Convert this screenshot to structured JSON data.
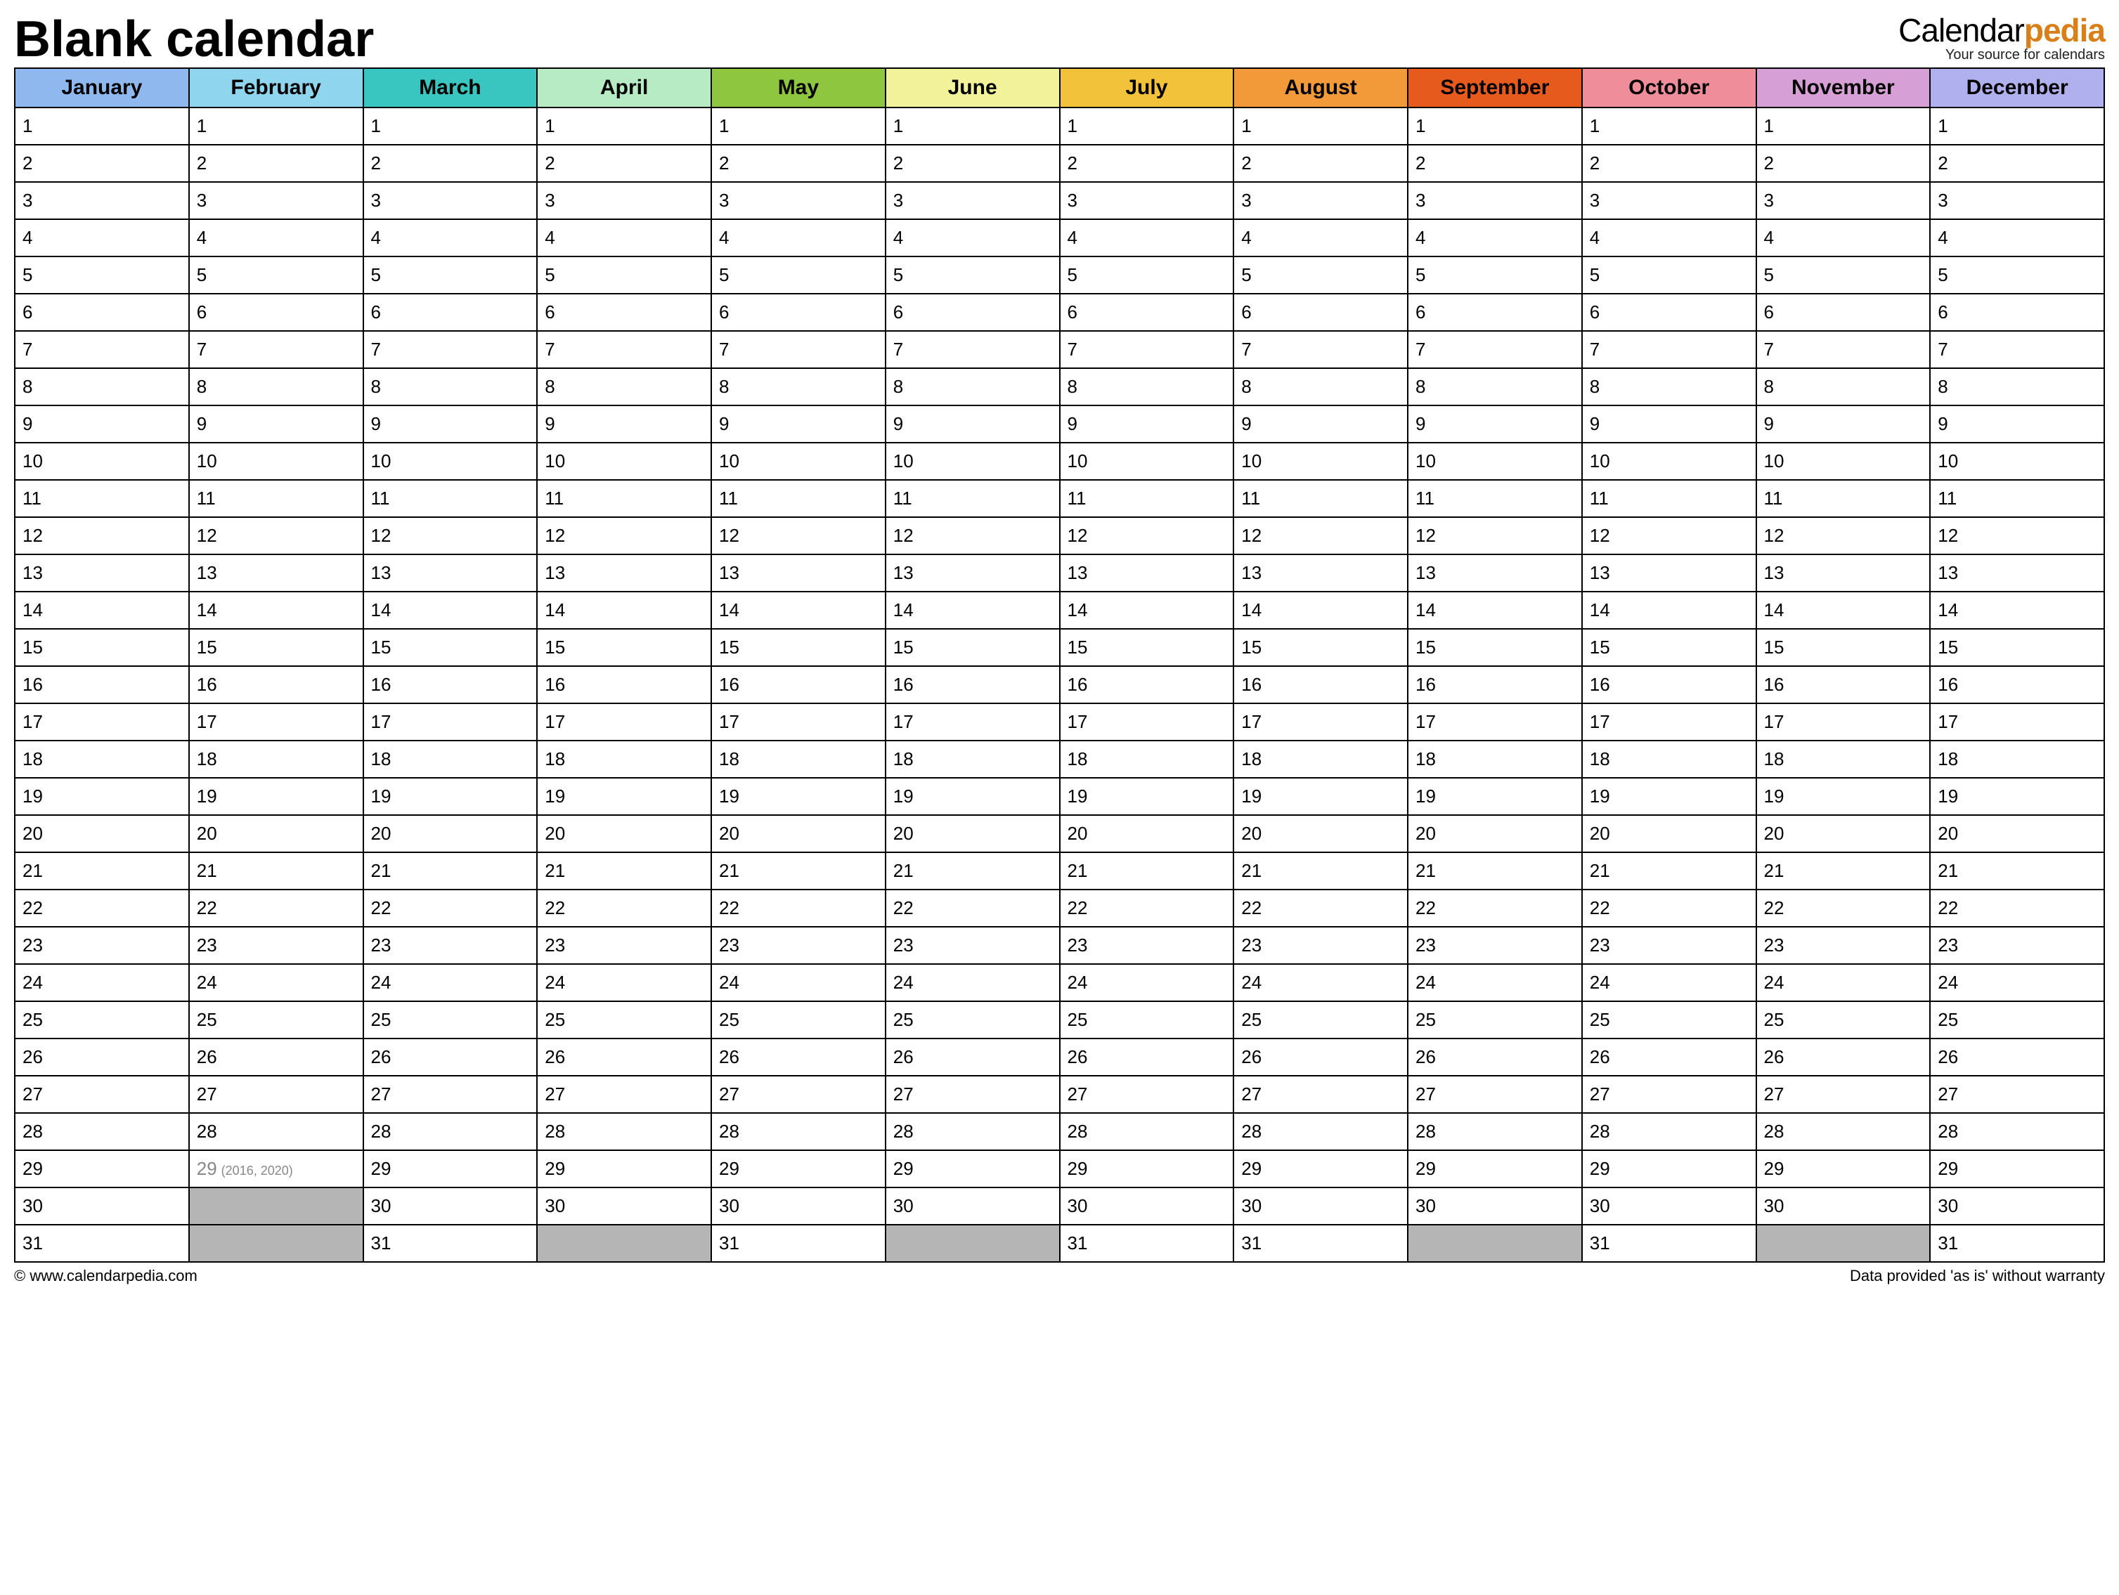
{
  "title": "Blank calendar",
  "brand": {
    "prefix": "Calendar",
    "accent": "pedia",
    "tagline": "Your source for calendars"
  },
  "footer": {
    "left": "© www.calendarpedia.com",
    "right": "Data provided 'as is' without warranty"
  },
  "months": [
    {
      "name": "January",
      "color": "#8fb8ee",
      "days": 31
    },
    {
      "name": "February",
      "color": "#8fd5ee",
      "days": 29,
      "last_day_dim": true,
      "last_day_note": "(2016, 2020)"
    },
    {
      "name": "March",
      "color": "#39c6c0",
      "days": 31
    },
    {
      "name": "April",
      "color": "#b7ebc4",
      "days": 30
    },
    {
      "name": "May",
      "color": "#8ec63f",
      "days": 31
    },
    {
      "name": "June",
      "color": "#f2f29a",
      "days": 30
    },
    {
      "name": "July",
      "color": "#f2c23a",
      "days": 31
    },
    {
      "name": "August",
      "color": "#f29a3a",
      "days": 31
    },
    {
      "name": "September",
      "color": "#e65a1e",
      "days": 30
    },
    {
      "name": "October",
      "color": "#ef8e9a",
      "days": 31
    },
    {
      "name": "November",
      "color": "#d6a0d6",
      "days": 30
    },
    {
      "name": "December",
      "color": "#b0b0ee",
      "days": 31
    }
  ],
  "max_rows": 31
}
